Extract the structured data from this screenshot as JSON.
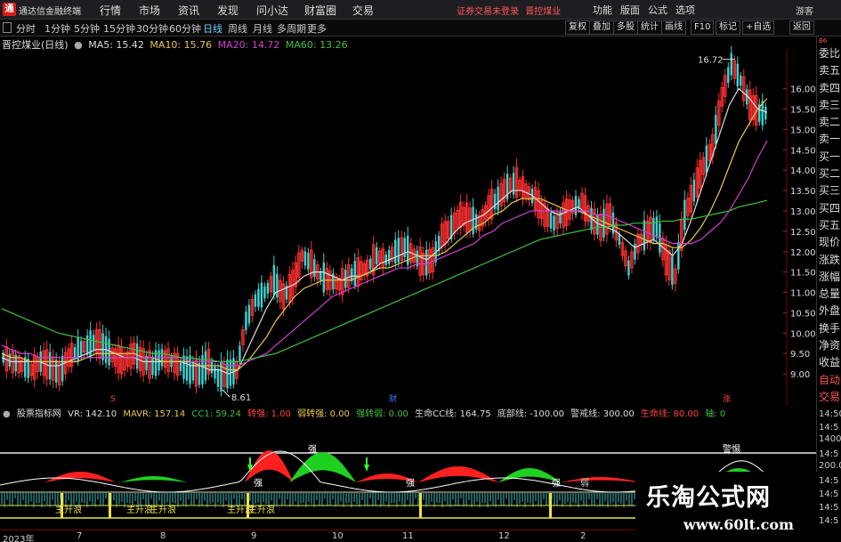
{
  "titlebar": {
    "logo": "通",
    "app_name": "通达信金融终端",
    "menus": [
      "行情",
      "市场",
      "资讯",
      "发现",
      "问小达",
      "财富圈",
      "交易"
    ],
    "login_text": "证券交易未登录",
    "stock_name_red": "晋控煤业",
    "right_menus": [
      "功能",
      "版面",
      "公式",
      "选项"
    ],
    "guest": "游客"
  },
  "toolbar": {
    "periods": [
      "分时",
      "1分钟",
      "5分钟",
      "15分钟",
      "30分钟",
      "60分钟",
      "日线",
      "周线",
      "月线",
      "多周期",
      "更多"
    ],
    "active_period": "日线",
    "right_buttons": [
      "复权",
      "叠加",
      "多股",
      "统计",
      "画线",
      "F10",
      "标记",
      "+自选",
      "返回"
    ]
  },
  "main_chart": {
    "stock_label": "晋控煤业(日线)",
    "ma": [
      {
        "label": "MA5: 15.42",
        "color": "#dddddd"
      },
      {
        "label": "MA10: 15.76",
        "color": "#e8c850"
      },
      {
        "label": "MA20: 14.72",
        "color": "#d040d0"
      },
      {
        "label": "MA60: 13.26",
        "color": "#40c040"
      }
    ],
    "high_label": "16.72",
    "low_label": "8.61",
    "markers": [
      {
        "text": "S"
      },
      {
        "text": "财"
      },
      {
        "text": "涨"
      }
    ]
  },
  "chart_data": {
    "type": "candlestick",
    "y_ticks": [
      "16.00",
      "15.50",
      "15.00",
      "14.50",
      "14.00",
      "13.50",
      "13.00",
      "12.50",
      "12.00",
      "11.50",
      "11.00",
      "10.50",
      "10.00",
      "9.50",
      "9.00"
    ],
    "ylim": [
      8.5,
      16.8
    ],
    "high": 16.72,
    "low": 8.61,
    "close_path": [
      9.4,
      9.3,
      9.2,
      9.1,
      9.3,
      9.2,
      9.0,
      9.4,
      9.6,
      9.7,
      9.8,
      9.6,
      9.4,
      9.3,
      9.5,
      9.3,
      9.2,
      9.4,
      9.3,
      9.2,
      9.1,
      9.0,
      9.3,
      8.9,
      9.0,
      9.1,
      10.3,
      10.8,
      11.0,
      11.3,
      10.9,
      11.2,
      11.9,
      11.7,
      11.4,
      11.3,
      11.2,
      11.4,
      11.5,
      11.6,
      11.9,
      11.8,
      12.0,
      12.1,
      11.9,
      11.7,
      11.8,
      12.4,
      12.6,
      12.9,
      12.8,
      12.7,
      13.1,
      13.3,
      13.6,
      13.7,
      13.5,
      13.3,
      12.9,
      12.7,
      12.9,
      13.1,
      13.2,
      12.8,
      12.6,
      12.9,
      12.3,
      11.6,
      12.2,
      12.5,
      12.6,
      11.8,
      11.4,
      12.9,
      13.5,
      14.1,
      14.6,
      15.8,
      16.6,
      16.2,
      15.6,
      15.4
    ],
    "ma_series": [
      {
        "name": "MA5",
        "color": "#dddddd",
        "values": [
          9.4,
          9.3,
          9.3,
          9.3,
          9.3,
          9.2,
          9.2,
          9.3,
          9.4,
          9.5,
          9.6,
          9.6,
          9.5,
          9.4,
          9.4,
          9.3,
          9.3,
          9.3,
          9.3,
          9.3,
          9.2,
          9.2,
          9.1,
          9.1,
          9.0,
          9.1,
          9.6,
          10.1,
          10.6,
          11.0,
          11.1,
          11.2,
          11.4,
          11.5,
          11.5,
          11.4,
          11.3,
          11.4,
          11.4,
          11.5,
          11.7,
          11.8,
          11.9,
          12.0,
          11.9,
          11.8,
          12.0,
          12.2,
          12.5,
          12.7,
          12.8,
          12.9,
          13.1,
          13.3,
          13.5,
          13.5,
          13.4,
          13.2,
          13.0,
          12.9,
          13.0,
          13.1,
          12.9,
          12.7,
          12.6,
          12.5,
          12.3,
          12.1,
          12.2,
          12.3,
          12.1,
          11.9,
          12.2,
          12.8,
          13.5,
          14.2,
          14.9,
          15.6,
          16.0,
          15.8,
          15.5,
          15.42
        ]
      },
      {
        "name": "MA10",
        "color": "#e8c850",
        "values": [
          9.5,
          9.4,
          9.4,
          9.3,
          9.3,
          9.3,
          9.3,
          9.3,
          9.3,
          9.4,
          9.5,
          9.5,
          9.5,
          9.5,
          9.5,
          9.4,
          9.4,
          9.3,
          9.3,
          9.3,
          9.3,
          9.2,
          9.2,
          9.2,
          9.1,
          9.1,
          9.3,
          9.6,
          9.9,
          10.3,
          10.6,
          10.9,
          11.1,
          11.2,
          11.3,
          11.3,
          11.3,
          11.3,
          11.4,
          11.5,
          11.6,
          11.6,
          11.7,
          11.8,
          11.9,
          11.9,
          11.9,
          12.0,
          12.2,
          12.4,
          12.6,
          12.7,
          12.9,
          13.0,
          13.2,
          13.3,
          13.3,
          13.3,
          13.2,
          13.1,
          13.0,
          13.0,
          12.9,
          12.8,
          12.7,
          12.6,
          12.5,
          12.4,
          12.3,
          12.2,
          12.2,
          12.1,
          12.1,
          12.3,
          12.6,
          13.0,
          13.5,
          14.1,
          14.7,
          15.1,
          15.5,
          15.76
        ]
      },
      {
        "name": "MA20",
        "color": "#d040d0",
        "values": [
          9.7,
          9.6,
          9.5,
          9.5,
          9.4,
          9.4,
          9.4,
          9.4,
          9.4,
          9.4,
          9.4,
          9.4,
          9.4,
          9.4,
          9.4,
          9.4,
          9.4,
          9.4,
          9.4,
          9.4,
          9.3,
          9.3,
          9.3,
          9.3,
          9.2,
          9.2,
          9.3,
          9.4,
          9.5,
          9.7,
          9.9,
          10.1,
          10.3,
          10.5,
          10.7,
          10.9,
          11.0,
          11.1,
          11.2,
          11.3,
          11.4,
          11.5,
          11.6,
          11.6,
          11.7,
          11.7,
          11.8,
          11.9,
          12.0,
          12.1,
          12.2,
          12.4,
          12.5,
          12.7,
          12.8,
          12.9,
          13.0,
          13.0,
          13.0,
          13.0,
          13.0,
          13.0,
          13.0,
          12.9,
          12.9,
          12.8,
          12.7,
          12.6,
          12.5,
          12.4,
          12.3,
          12.2,
          12.2,
          12.2,
          12.3,
          12.5,
          12.7,
          13.0,
          13.4,
          13.8,
          14.3,
          14.72
        ]
      },
      {
        "name": "MA60",
        "color": "#40c040",
        "values": [
          10.6,
          10.5,
          10.4,
          10.3,
          10.2,
          10.1,
          10.0,
          9.95,
          9.9,
          9.85,
          9.8,
          9.75,
          9.7,
          9.65,
          9.6,
          9.55,
          9.5,
          9.5,
          9.45,
          9.4,
          9.4,
          9.35,
          9.35,
          9.3,
          9.3,
          9.3,
          9.35,
          9.4,
          9.45,
          9.5,
          9.6,
          9.7,
          9.8,
          9.9,
          10.0,
          10.1,
          10.2,
          10.3,
          10.4,
          10.5,
          10.6,
          10.7,
          10.8,
          10.9,
          11.0,
          11.1,
          11.2,
          11.3,
          11.4,
          11.5,
          11.6,
          11.7,
          11.8,
          11.9,
          12.0,
          12.1,
          12.2,
          12.3,
          12.35,
          12.4,
          12.45,
          12.5,
          12.55,
          12.6,
          12.6,
          12.65,
          12.65,
          12.7,
          12.7,
          12.7,
          12.75,
          12.75,
          12.8,
          12.8,
          12.85,
          12.9,
          12.95,
          13.0,
          13.1,
          13.15,
          13.2,
          13.26
        ]
      }
    ]
  },
  "right_panel": {
    "top_small": "B6",
    "items": [
      "委比",
      "卖五",
      "卖四",
      "卖三",
      "卖二",
      "卖一",
      "买一",
      "买二",
      "买三",
      "买四",
      "买五",
      "现价",
      "涨跌",
      "涨幅",
      "总量",
      "外盘",
      "换手",
      "净资",
      "收益",
      "自动",
      "交易"
    ]
  },
  "indicator": {
    "name": "股票指标网",
    "values": [
      {
        "label": "VR: 142.10",
        "color": "#dddddd"
      },
      {
        "label": "MAVR: 157.14",
        "color": "#e8c850"
      },
      {
        "label": "CC1: 59.24",
        "color": "#40c040"
      },
      {
        "label": "转强: 1.00",
        "color": "#ff4040"
      },
      {
        "label": "弱转强: 0.00",
        "color": "#e8c850"
      },
      {
        "label": "强转弱: 0.00",
        "color": "#40c040"
      },
      {
        "label": "生命CC线: 164.75",
        "color": "#dddddd"
      },
      {
        "label": "底部线: -100.00",
        "color": "#dddddd"
      },
      {
        "label": "警戒线: 300.00",
        "color": "#dddddd"
      },
      {
        "label": "生命线: 80.00",
        "color": "#ff4040"
      },
      {
        "label": "轴: 0",
        "color": "#40c040"
      }
    ],
    "labels": [
      "主升浪",
      "主升浪",
      "主升浪",
      "主升浪",
      "主升浪",
      "强",
      "强",
      "强",
      "强",
      "弱",
      "警惕"
    ],
    "y_ticks": [
      "1400.0",
      "200.0"
    ]
  },
  "right_times": [
    "14:50",
    "14:5",
    "14:5",
    "14:5",
    "14:5",
    "14:5",
    "14:5",
    "14:5",
    "14:5"
  ],
  "dates": [
    "2023年",
    "7",
    "8",
    "9",
    "10",
    "11",
    "12",
    "2"
  ],
  "watermark": {
    "title": "乐淘公式网",
    "url": "www.60lt.com"
  }
}
